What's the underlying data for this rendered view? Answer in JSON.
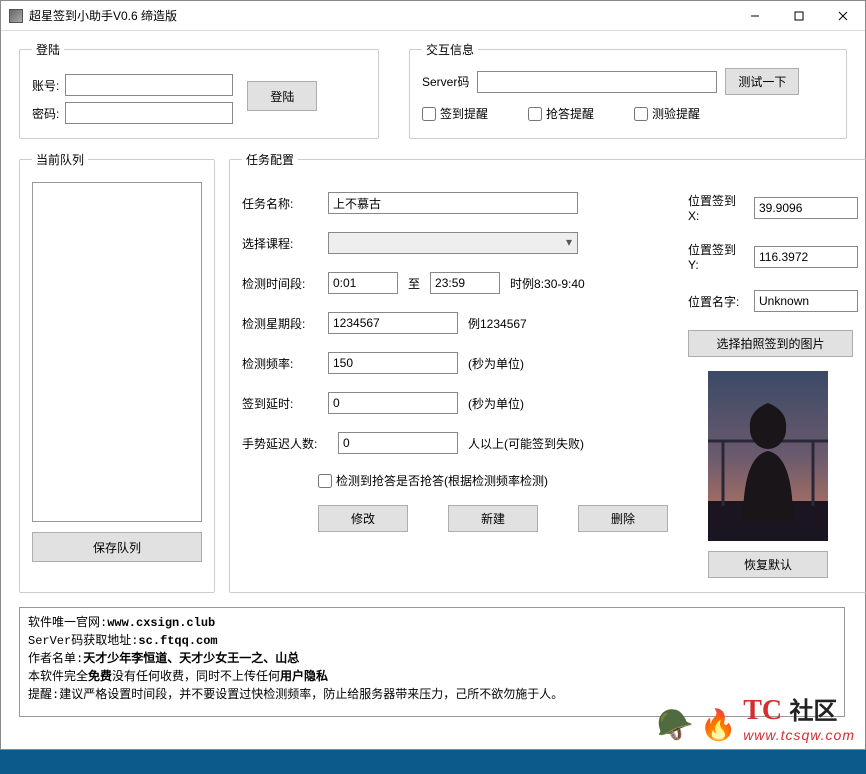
{
  "window": {
    "title": "超星签到小助手V0.6 缔造版"
  },
  "login": {
    "legend": "登陆",
    "account_label": "账号:",
    "password_label": "密码:",
    "account_value": "",
    "password_value": "",
    "login_btn": "登陆"
  },
  "info": {
    "legend": "交互信息",
    "server_label": "Server码",
    "server_value": "",
    "test_btn": "测试一下",
    "chk_signin": "签到提醒",
    "chk_answer": "抢答提醒",
    "chk_test": "测验提醒"
  },
  "queue": {
    "legend": "当前队列",
    "save_btn": "保存队列"
  },
  "task": {
    "legend": "任务配置",
    "name_label": "任务名称:",
    "name_value": "上不慕古",
    "course_label": "选择课程:",
    "course_value": "",
    "time_label": "检测时间段:",
    "time_from": "0:01",
    "time_to_label": "至",
    "time_to": "23:59",
    "time_hint": "时例8:30-9:40",
    "week_label": "检测星期段:",
    "week_value": "1234567",
    "week_hint": "例1234567",
    "freq_label": "检测频率:",
    "freq_value": "150",
    "freq_hint": "(秒为单位)",
    "delay_label": "签到延时:",
    "delay_value": "0",
    "delay_hint": "(秒为单位)",
    "gesture_label": "手势延迟人数:",
    "gesture_value": "0",
    "gesture_hint": "人以上(可能签到失败)",
    "chk_answer": "检测到抢答是否抢答(根据检测频率检测)",
    "btn_modify": "修改",
    "btn_new": "新建",
    "btn_delete": "删除",
    "loc_x_label": "位置签到X:",
    "loc_x_value": "39.9096",
    "loc_y_label": "位置签到Y:",
    "loc_y_value": "116.3972",
    "loc_name_label": "位置名字:",
    "loc_name_value": "Unknown",
    "photo_btn": "选择拍照签到的图片",
    "restore_btn": "恢复默认"
  },
  "log": {
    "l1a": "软件唯一官网:",
    "l1b": "www.cxsign.club",
    "l2a": "SerVer码获取地址:",
    "l2b": "sc.ftqq.com",
    "l3a": "作者名单:",
    "l3b": "天才少年李恒道、天才少女王一之、山总",
    "l4a": "本软件完全",
    "l4b": "免费",
    "l4c": "没有任何收费，同时不上传任何",
    "l4d": "用户隐私",
    "l5": "提醒:建议严格设置时间段，并不要设置过快检测频率，防止给服务器带来压力，己所不欲勿施于人。"
  },
  "watermark": {
    "tc": "TC",
    "sq": "社区",
    "url": "www.tcsqw.com"
  }
}
